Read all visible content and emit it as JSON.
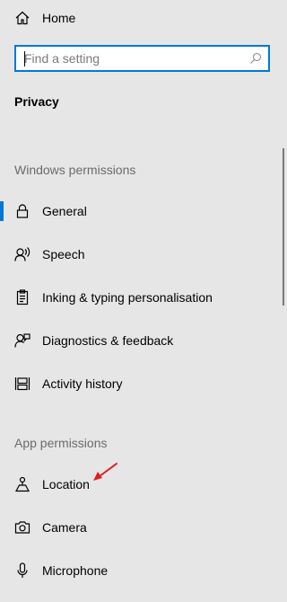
{
  "nav": {
    "home_label": "Home"
  },
  "search": {
    "placeholder": "Find a setting",
    "value": ""
  },
  "page": {
    "title": "Privacy"
  },
  "windows_permissions": {
    "title": "Windows permissions",
    "items": [
      {
        "label": "General",
        "icon": "lock-icon",
        "selected": true
      },
      {
        "label": "Speech",
        "icon": "speech-icon",
        "selected": false
      },
      {
        "label": "Inking & typing personalisation",
        "icon": "clipboard-icon",
        "selected": false
      },
      {
        "label": "Diagnostics & feedback",
        "icon": "diagnostics-icon",
        "selected": false
      },
      {
        "label": "Activity history",
        "icon": "timeline-icon",
        "selected": false
      }
    ]
  },
  "app_permissions": {
    "title": "App permissions",
    "items": [
      {
        "label": "Location",
        "icon": "location-icon"
      },
      {
        "label": "Camera",
        "icon": "camera-icon"
      },
      {
        "label": "Microphone",
        "icon": "microphone-icon"
      }
    ]
  },
  "colors": {
    "accent": "#0078d7",
    "background": "#e6e6e6",
    "annotation_arrow": "#e02020"
  }
}
